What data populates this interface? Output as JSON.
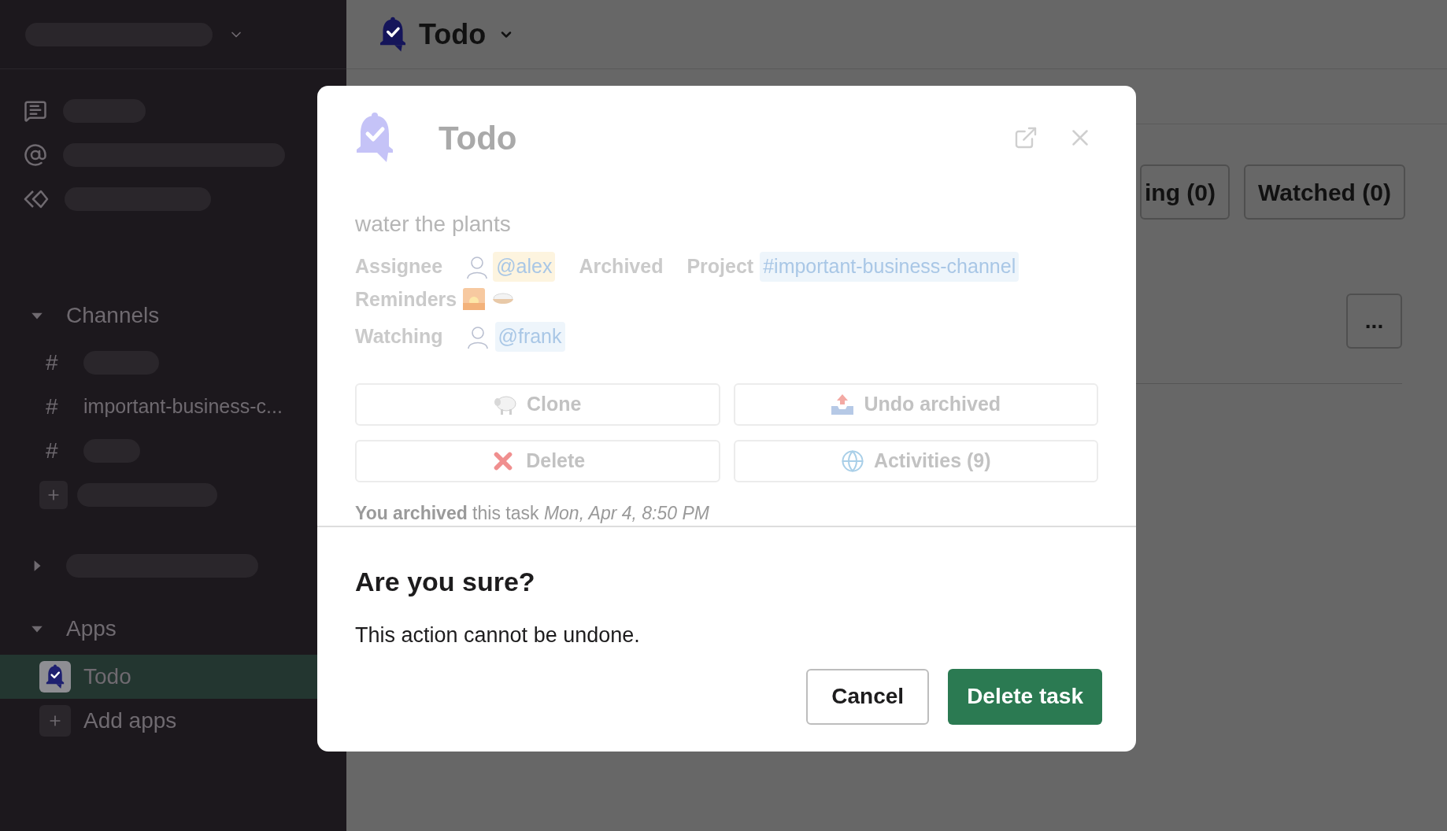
{
  "sidebar": {
    "channels_section": {
      "label": "Channels",
      "expanded": true,
      "items": [
        {
          "kind": "placeholder",
          "prefix": "#"
        },
        {
          "kind": "channel",
          "prefix": "#",
          "name": "important-business-c..."
        },
        {
          "kind": "placeholder",
          "prefix": "#"
        }
      ]
    },
    "apps_section": {
      "label": "Apps",
      "expanded": true,
      "items": [
        {
          "kind": "app",
          "name": "Todo",
          "selected": true
        },
        {
          "kind": "add",
          "name": "Add apps",
          "selected": false
        }
      ]
    }
  },
  "header": {
    "title": "Todo"
  },
  "filter_buttons": [
    {
      "label": "ing (0)"
    },
    {
      "label": "Watched (0)"
    }
  ],
  "more_button": {
    "label": "..."
  },
  "modal": {
    "title": "Todo",
    "task": {
      "title": "water the plants",
      "assignee_label": "Assignee",
      "assignee": "@alex",
      "status": "Archived",
      "project_label": "Project",
      "project": "#important-business-channel",
      "reminders_label": "Reminders",
      "watching_label": "Watching",
      "watchers": [
        "@frank"
      ]
    },
    "actions": [
      {
        "kind": "clone",
        "label": "Clone"
      },
      {
        "kind": "unarchive",
        "label": "Undo archived"
      },
      {
        "kind": "delete",
        "label": "Delete"
      },
      {
        "kind": "activities",
        "label": "Activities (9)"
      }
    ],
    "history": "**You archived** this task *Mon, Apr 4, 8:50 PM*"
  },
  "confirm": {
    "title": "Are you sure?",
    "message": "This action cannot be undone.",
    "buttons": [
      {
        "kind": "secondary",
        "label": "Cancel"
      },
      {
        "kind": "primary",
        "label": "Delete task"
      }
    ]
  }
}
